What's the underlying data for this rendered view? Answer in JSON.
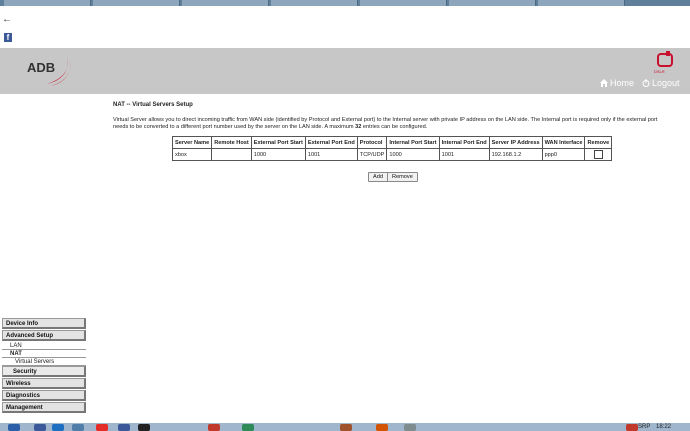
{
  "browser": {
    "back_icon": "back-arrow-icon",
    "side_icon": "facebook-icon"
  },
  "header": {
    "logo_text": "ADB",
    "brand_text": "DSLR",
    "home_label": "Home",
    "logout_label": "Logout",
    "home_icon": "home-icon",
    "logout_icon": "logout-icon"
  },
  "sidebar": {
    "items": [
      {
        "label": "Device Info"
      },
      {
        "label": "Advanced Setup"
      },
      {
        "label": "LAN"
      },
      {
        "label": "NAT"
      },
      {
        "label": "Virtual Servers"
      },
      {
        "label": "Security"
      },
      {
        "label": "Wireless"
      },
      {
        "label": "Diagnostics"
      },
      {
        "label": "Management"
      }
    ]
  },
  "main": {
    "title": "NAT -- Virtual Servers Setup",
    "description_part1": "Virtual Server allows you to direct incoming traffic from WAN side (identified by Protocol and External port) to the Internal server with private IP address on the LAN side. The Internal port is required only if the external port needs to be converted to a different port number used by the server on the LAN side. A maximum ",
    "description_max": "32",
    "description_part2": " entries can be configured.",
    "table": {
      "headers": [
        "Server Name",
        "Remote Host",
        "External Port Start",
        "External Port End",
        "Protocol",
        "Internal Port Start",
        "Internal Port End",
        "Server IP Address",
        "WAN Interface",
        "Remove"
      ],
      "rows": [
        {
          "server_name": "xbox",
          "remote_host": "",
          "ext_start": "1000",
          "ext_end": "1001",
          "protocol": "TCP/UDP",
          "int_start": "1000",
          "int_end": "1001",
          "server_ip": "192.168.1.2",
          "wan": "ppp0"
        }
      ]
    },
    "add_label": "Add",
    "remove_label": "Remove"
  },
  "taskbar": {
    "lang": "SRP",
    "time": "18:22"
  },
  "colors": {
    "header_bg": "#c7c7c7",
    "brand_red": "#c8102e",
    "taskbar": "#9fb6cc"
  }
}
